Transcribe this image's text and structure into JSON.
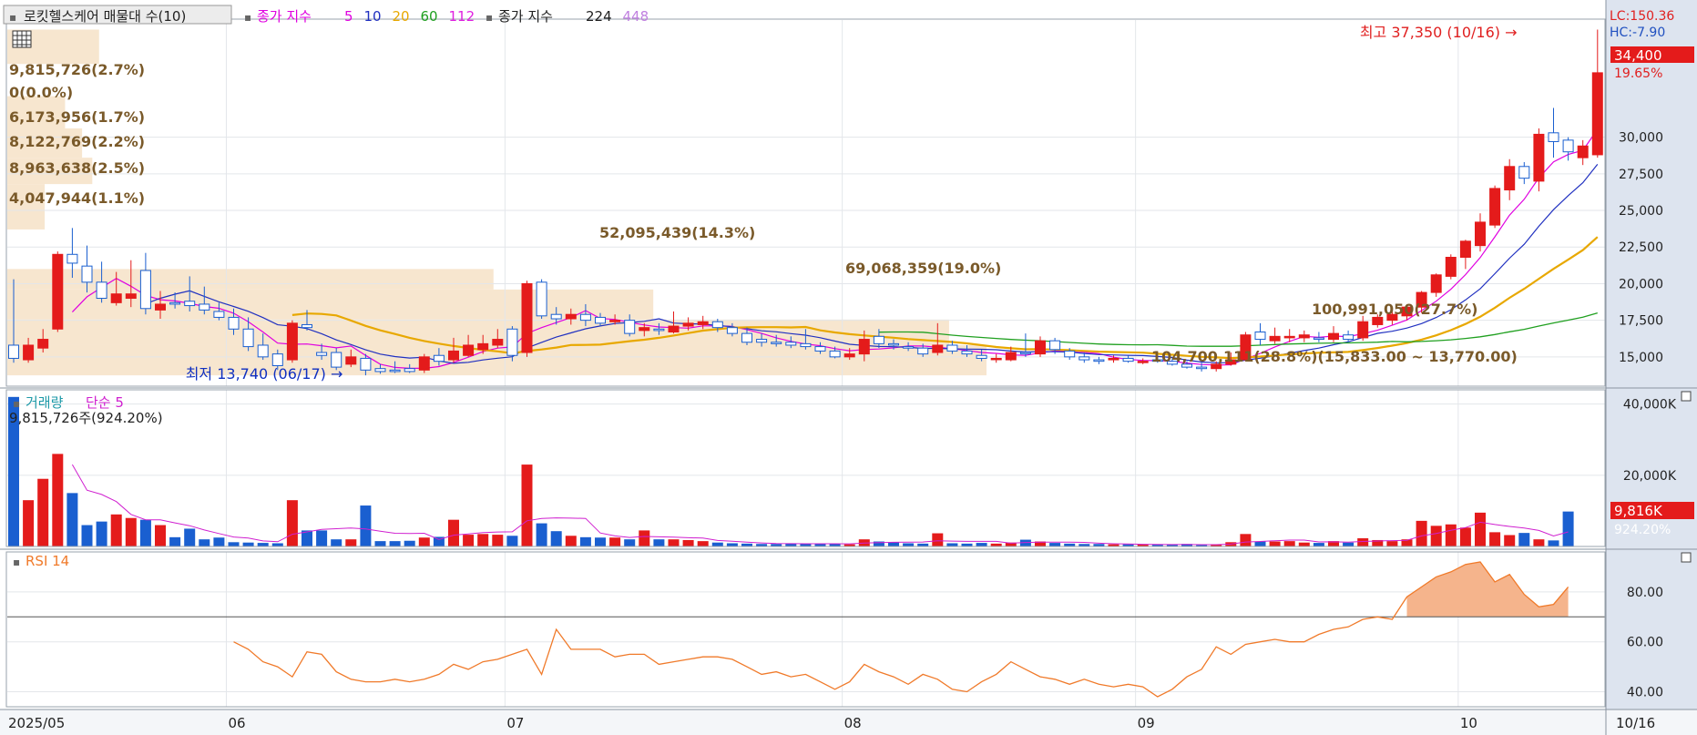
{
  "header": {
    "main_title": "로킷헬스케어 매물대 수(10)",
    "ma_prefix": "종가 지수",
    "ma_periods": [
      "5",
      "10",
      "20",
      "60",
      "112"
    ],
    "ma_colors": [
      "#e000e0",
      "#2030c0",
      "#e8a800",
      "#20a020",
      "#e020e0"
    ],
    "ma2_prefix": "종가 지수",
    "ma2_periods": [
      "224",
      "448"
    ],
    "ma2_colors": [
      "#202020",
      "#c080e0"
    ]
  },
  "colors": {
    "up": "#e41b1b",
    "down": "#1a5fd0",
    "volume_band": "#f7e6cf",
    "axis_bg": "#dde4ef",
    "rsi": "#f07a2a"
  },
  "right_labels": {
    "lc": "LC:150.36",
    "hc": "HC:-7.90",
    "last_price": "34,400",
    "change_pct": "19.65%",
    "vol_last": "9,816K",
    "vol_pct": "924.20%"
  },
  "chart_data": [
    {
      "type": "candlestick",
      "title": "로킷헬스케어 매물대 수(10)",
      "x_ticks": [
        {
          "index": 0,
          "label": "2025/05"
        },
        {
          "index": 15,
          "label": "06"
        },
        {
          "index": 34,
          "label": "07"
        },
        {
          "index": 57,
          "label": "08"
        },
        {
          "index": 77,
          "label": "09"
        },
        {
          "index": 99,
          "label": "10"
        }
      ],
      "x_end_label": "10/16",
      "y_ticks": [
        15000,
        17500,
        20000,
        22500,
        25000,
        27500,
        30000
      ],
      "y_tick_labels": [
        "15,000",
        "17,500",
        "20,000",
        "22,500",
        "25,000",
        "27,500",
        "30,000"
      ],
      "ylim": [
        13000,
        38000
      ],
      "high_marker": {
        "index": 105,
        "label": "최고 37,350 (10/16)"
      },
      "low_marker": {
        "index": 24,
        "label": "최저 13,740 (06/17)"
      },
      "candles": [
        [
          15800,
          14900,
          20300,
          14600
        ],
        [
          14800,
          15800,
          16300,
          14600
        ],
        [
          15600,
          16200,
          16900,
          15300
        ],
        [
          16900,
          22000,
          22200,
          16700
        ],
        [
          22000,
          21400,
          23800,
          20400
        ],
        [
          21200,
          20100,
          22600,
          19400
        ],
        [
          20100,
          19000,
          21500,
          18700
        ],
        [
          18700,
          19300,
          20800,
          18500
        ],
        [
          19000,
          19300,
          21600,
          18400
        ],
        [
          20900,
          18300,
          22100,
          17900
        ],
        [
          18200,
          18600,
          19500,
          17600
        ],
        [
          18700,
          18600,
          19400,
          18300
        ],
        [
          18800,
          18500,
          20500,
          18100
        ],
        [
          18600,
          18200,
          19800,
          17900
        ],
        [
          18100,
          17700,
          18700,
          17500
        ],
        [
          17700,
          16900,
          18300,
          16500
        ],
        [
          16900,
          15700,
          17700,
          15400
        ],
        [
          15800,
          15000,
          16600,
          14800
        ],
        [
          15200,
          14400,
          15500,
          14100
        ],
        [
          14800,
          17300,
          17500,
          14600
        ],
        [
          17200,
          17000,
          18200,
          16800
        ],
        [
          15300,
          15100,
          15900,
          14800
        ],
        [
          15300,
          14300,
          15600,
          14100
        ],
        [
          14500,
          15000,
          15500,
          14300
        ],
        [
          14900,
          14100,
          15200,
          13740
        ],
        [
          14200,
          14000,
          14500,
          13850
        ],
        [
          14100,
          14000,
          14700,
          13900
        ],
        [
          14200,
          14000,
          14500,
          13900
        ],
        [
          14100,
          15000,
          15200,
          13900
        ],
        [
          15100,
          14700,
          15600,
          14400
        ],
        [
          14800,
          15400,
          16300,
          14600
        ],
        [
          15100,
          15800,
          16500,
          15000
        ],
        [
          15500,
          15900,
          16500,
          15200
        ],
        [
          15800,
          16200,
          16900,
          15600
        ],
        [
          16900,
          15100,
          17100,
          14700
        ],
        [
          15300,
          20000,
          20200,
          15000
        ],
        [
          20100,
          17800,
          20300,
          17600
        ],
        [
          17900,
          17600,
          18400,
          17200
        ],
        [
          17600,
          17900,
          18300,
          17200
        ],
        [
          17900,
          17500,
          18600,
          17100
        ],
        [
          17700,
          17300,
          18000,
          17100
        ],
        [
          17400,
          17500,
          17900,
          17200
        ],
        [
          17500,
          16600,
          17900,
          16400
        ],
        [
          16800,
          17000,
          17300,
          16400
        ],
        [
          16900,
          16800,
          17300,
          16500
        ],
        [
          16700,
          17100,
          18100,
          16600
        ],
        [
          17100,
          17300,
          17700,
          16800
        ],
        [
          17200,
          17400,
          17800,
          16900
        ],
        [
          17400,
          17000,
          17600,
          16700
        ],
        [
          17000,
          16600,
          17300,
          16400
        ],
        [
          16600,
          16000,
          17000,
          15800
        ],
        [
          16200,
          16000,
          16600,
          15700
        ],
        [
          16000,
          15900,
          16500,
          15700
        ],
        [
          16000,
          15800,
          16400,
          15600
        ],
        [
          15900,
          15700,
          16900,
          15500
        ],
        [
          15700,
          15400,
          16000,
          15200
        ],
        [
          15400,
          15000,
          15700,
          14900
        ],
        [
          15000,
          15200,
          15600,
          14800
        ],
        [
          15200,
          16200,
          16800,
          14700
        ],
        [
          16400,
          15900,
          16900,
          15600
        ],
        [
          15900,
          15800,
          16200,
          15500
        ],
        [
          15700,
          15600,
          16000,
          15400
        ],
        [
          15600,
          15200,
          15900,
          15000
        ],
        [
          15300,
          15800,
          17300,
          15100
        ],
        [
          15800,
          15400,
          16100,
          15200
        ],
        [
          15400,
          15200,
          15800,
          15000
        ],
        [
          15100,
          14900,
          15500,
          14700
        ],
        [
          14900,
          14900,
          15200,
          14600
        ],
        [
          14800,
          15300,
          15700,
          14700
        ],
        [
          15300,
          15200,
          16600,
          15000
        ],
        [
          15200,
          16100,
          16400,
          15000
        ],
        [
          16100,
          15500,
          16300,
          15200
        ],
        [
          15400,
          15000,
          15600,
          14800
        ],
        [
          15000,
          14800,
          15300,
          14600
        ],
        [
          14800,
          14700,
          15000,
          14500
        ],
        [
          14800,
          14900,
          15100,
          14600
        ],
        [
          14900,
          14700,
          15100,
          14600
        ],
        [
          14700,
          14700,
          14900,
          14500
        ],
        [
          14800,
          14700,
          15000,
          14600
        ],
        [
          14700,
          14500,
          14900,
          14400
        ],
        [
          14500,
          14300,
          14700,
          14200
        ],
        [
          14300,
          14200,
          14600,
          14000
        ],
        [
          14200,
          14500,
          14700,
          14000
        ],
        [
          14500,
          14800,
          15300,
          14400
        ],
        [
          14800,
          16500,
          16700,
          14700
        ],
        [
          16700,
          16200,
          17300,
          15800
        ],
        [
          16100,
          16400,
          17000,
          15900
        ],
        [
          16300,
          16400,
          16900,
          16000
        ],
        [
          16300,
          16500,
          16800,
          16000
        ],
        [
          16300,
          16200,
          16700,
          16000
        ],
        [
          16200,
          16600,
          17100,
          16000
        ],
        [
          16500,
          16200,
          16800,
          16000
        ],
        [
          16300,
          17400,
          17800,
          16100
        ],
        [
          17200,
          17700,
          17900,
          17000
        ],
        [
          17500,
          17900,
          18200,
          17200
        ],
        [
          17800,
          18400,
          18600,
          17500
        ],
        [
          18400,
          19400,
          19500,
          18000
        ],
        [
          19400,
          20600,
          20700,
          19100
        ],
        [
          20500,
          21800,
          22000,
          20300
        ],
        [
          21800,
          22900,
          23000,
          21000
        ],
        [
          22600,
          24200,
          24800,
          22200
        ],
        [
          24000,
          26500,
          26700,
          23800
        ],
        [
          26400,
          28000,
          28500,
          25700
        ],
        [
          28000,
          27200,
          28300,
          26800
        ],
        [
          27000,
          30200,
          30600,
          26300
        ],
        [
          30300,
          29700,
          32000,
          28600
        ],
        [
          29800,
          29000,
          30000,
          28400
        ],
        [
          28600,
          29400,
          29800,
          28100
        ],
        [
          28800,
          34400,
          37350,
          28600
        ]
      ],
      "volume_profile": [
        {
          "label": "9,815,726(2.7%)"
        },
        {
          "label": "0(0.0%)"
        },
        {
          "label": "6,173,956(1.7%)"
        },
        {
          "label": "8,122,769(2.2%)"
        },
        {
          "label": "8,963,638(2.5%)"
        },
        {
          "label": "4,047,944(1.1%)"
        },
        {
          "label": "52,095,439(14.3%)"
        },
        {
          "label": "69,068,359(19.0%)"
        },
        {
          "label": "100,991,050(27.7%)"
        },
        {
          "label": "104,700,111(28.8%)(15,833.00 ~ 13,770.00)"
        }
      ]
    },
    {
      "type": "bar",
      "title": "거래량",
      "ma_label": "단순 5",
      "y_tick_labels": [
        "20,000K",
        "40,000K"
      ],
      "ylim": [
        0,
        44000
      ],
      "last_label": "9,815,726주(924.20%)",
      "values": [
        42000,
        13000,
        19000,
        26000,
        15000,
        6000,
        7000,
        9000,
        8000,
        7500,
        6000,
        2600,
        5000,
        2000,
        2500,
        1200,
        1100,
        1000,
        900,
        13000,
        4500,
        4500,
        2000,
        2000,
        11500,
        1500,
        1500,
        1600,
        2500,
        2700,
        7500,
        3300,
        3500,
        3300,
        3000,
        23000,
        6500,
        4300,
        3000,
        2600,
        2500,
        2500,
        2000,
        4500,
        2000,
        2000,
        1800,
        1500,
        1100,
        900,
        800,
        700,
        700,
        900,
        800,
        700,
        700,
        600,
        2000,
        1400,
        1200,
        900,
        800,
        3700,
        900,
        800,
        1000,
        800,
        1100,
        1900,
        1400,
        1000,
        800,
        700,
        700,
        600,
        600,
        500,
        500,
        500,
        700,
        400,
        500,
        1200,
        3500,
        1400,
        1400,
        1500,
        1100,
        1000,
        1500,
        1100,
        2300,
        1800,
        1500,
        2000,
        7200,
        5800,
        6200,
        5300,
        9500,
        4000,
        3200,
        3800,
        2000,
        1700,
        9816
      ]
    },
    {
      "type": "area",
      "title": "RSI 14",
      "y_tick_labels": [
        "40.00",
        "60.00",
        "80.00"
      ],
      "ylim": [
        34,
        96
      ],
      "reference": 70,
      "start_index": 15,
      "values": [
        60,
        57,
        52,
        50,
        46,
        56,
        55,
        48,
        45,
        44,
        44,
        45,
        44,
        45,
        47,
        51,
        49,
        52,
        53,
        55,
        57,
        47,
        65,
        57,
        57,
        57,
        54,
        55,
        55,
        51,
        52,
        53,
        54,
        54,
        53,
        50,
        47,
        48,
        46,
        47,
        44,
        41,
        44,
        51,
        48,
        46,
        43,
        47,
        45,
        41,
        40,
        44,
        47,
        52,
        49,
        46,
        45,
        43,
        45,
        43,
        42,
        43,
        42,
        38,
        41,
        46,
        49,
        58,
        55,
        59,
        60,
        61,
        60,
        60,
        63,
        65,
        66,
        69,
        70,
        69,
        78,
        82,
        86,
        88,
        91,
        92,
        84,
        87,
        79,
        74,
        75,
        82
      ]
    }
  ]
}
